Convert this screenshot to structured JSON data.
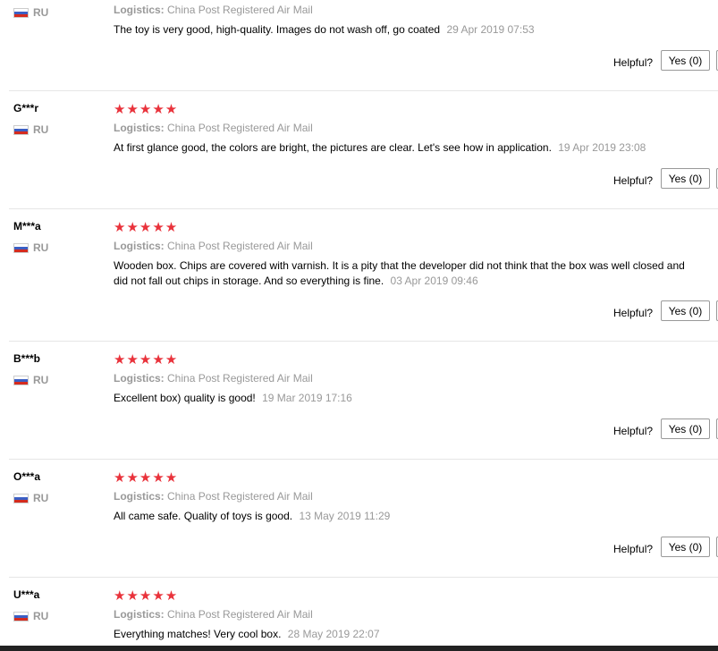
{
  "reviews": [
    {
      "user": "",
      "country": "RU",
      "stars": "★★★★★",
      "logistics_label": "Logistics:",
      "logistics_value": "China Post Registered Air Mail",
      "text": "The toy is very good, high-quality. Images do not wash off, go coated",
      "date": "29 Apr 2019 07:53",
      "helpful_label": "Helpful?",
      "yes_label": "Yes (0)"
    },
    {
      "user": "G***r",
      "country": "RU",
      "stars": "★★★★★",
      "logistics_label": "Logistics:",
      "logistics_value": "China Post Registered Air Mail",
      "text": "At first glance good, the colors are bright, the pictures are clear. Let's see how in application.",
      "date": "19 Apr 2019 23:08",
      "helpful_label": "Helpful?",
      "yes_label": "Yes (0)"
    },
    {
      "user": "M***a",
      "country": "RU",
      "stars": "★★★★★",
      "logistics_label": "Logistics:",
      "logistics_value": "China Post Registered Air Mail",
      "text": "Wooden box. Chips are covered with varnish. It is a pity that the developer did not think that the box was well closed and did not fall out chips in storage. And so everything is fine.",
      "date": "03 Apr 2019 09:46",
      "helpful_label": "Helpful?",
      "yes_label": "Yes (0)"
    },
    {
      "user": "B***b",
      "country": "RU",
      "stars": "★★★★★",
      "logistics_label": "Logistics:",
      "logistics_value": "China Post Registered Air Mail",
      "text": "Excellent box) quality is good!",
      "date": "19 Mar 2019 17:16",
      "helpful_label": "Helpful?",
      "yes_label": "Yes (0)"
    },
    {
      "user": "O***a",
      "country": "RU",
      "stars": "★★★★★",
      "logistics_label": "Logistics:",
      "logistics_value": "China Post Registered Air Mail",
      "text": "All came safe. Quality of toys is good.",
      "date": "13 May 2019 11:29",
      "helpful_label": "Helpful?",
      "yes_label": "Yes (0)"
    },
    {
      "user": "U***a",
      "country": "RU",
      "stars": "★★★★★",
      "logistics_label": "Logistics:",
      "logistics_value": "China Post Registered Air Mail",
      "text": "Everything matches! Very cool box.",
      "date": "28 May 2019 22:07",
      "helpful_label": "",
      "yes_label": ""
    }
  ],
  "colors": {
    "star": "#e9323b",
    "muted": "#999999",
    "divider": "#e6e6e6"
  }
}
